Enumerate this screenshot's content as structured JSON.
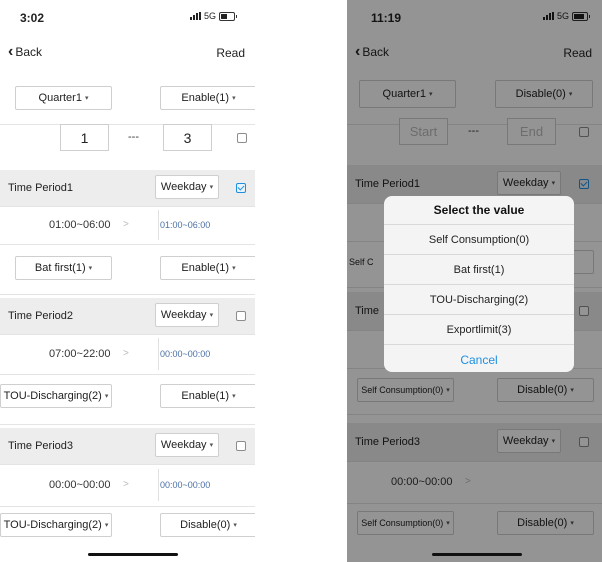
{
  "left": {
    "status": {
      "time": "3:02",
      "network": "5G"
    },
    "nav": {
      "back_label": "Back",
      "read_label": "Read"
    },
    "quarter": {
      "label": "Quarter1",
      "enable": "Enable(1)"
    },
    "range": {
      "start": "1",
      "sep": "---",
      "end": "3"
    },
    "periods": [
      {
        "label": "Time Period1",
        "day": "Weekday",
        "checked": true,
        "range": "01:00~06:00",
        "range2": "01:00~06:00",
        "mode": "Bat first(1)",
        "enable": "Enable(1)"
      },
      {
        "label": "Time Period2",
        "day": "Weekday",
        "checked": false,
        "range": "07:00~22:00",
        "range2": "00:00~00:00",
        "mode": "TOU-Discharging(2)",
        "enable": "Enable(1)"
      },
      {
        "label": "Time Period3",
        "day": "Weekday",
        "checked": false,
        "range": "00:00~00:00",
        "range2": "00:00~00:00",
        "mode": "TOU-Discharging(2)",
        "enable": "Disable(0)"
      }
    ]
  },
  "right": {
    "status": {
      "time": "11:19",
      "network": "5G"
    },
    "nav": {
      "back_label": "Back",
      "read_label": "Read"
    },
    "quarter": {
      "label": "Quarter1",
      "enable": "Disable(0)"
    },
    "range": {
      "start_placeholder": "Start",
      "sep": "---",
      "end_placeholder": "End"
    },
    "periods": [
      {
        "label": "Time Period1",
        "day": "Weekday",
        "checked": true,
        "mode_partial": "Self C"
      },
      {
        "label": "Time",
        "mode": "Self Consumption(0)",
        "enable": "Disable(0)"
      },
      {
        "label": "Time Period3",
        "day": "Weekday",
        "checked": false,
        "range": "00:00~00:00",
        "mode": "Self Consumption(0)",
        "enable": "Disable(0)"
      }
    ],
    "dialog": {
      "title": "Select the value",
      "options": [
        "Self Consumption(0)",
        "Bat first(1)",
        "TOU-Discharging(2)",
        "Exportlimit(3)"
      ],
      "cancel": "Cancel"
    }
  },
  "icons": {
    "arrow": "▾",
    "gt": ">",
    "back_chevron": "‹"
  },
  "colors": {
    "accent": "#1f8fe0",
    "section_bg": "#ededed"
  }
}
